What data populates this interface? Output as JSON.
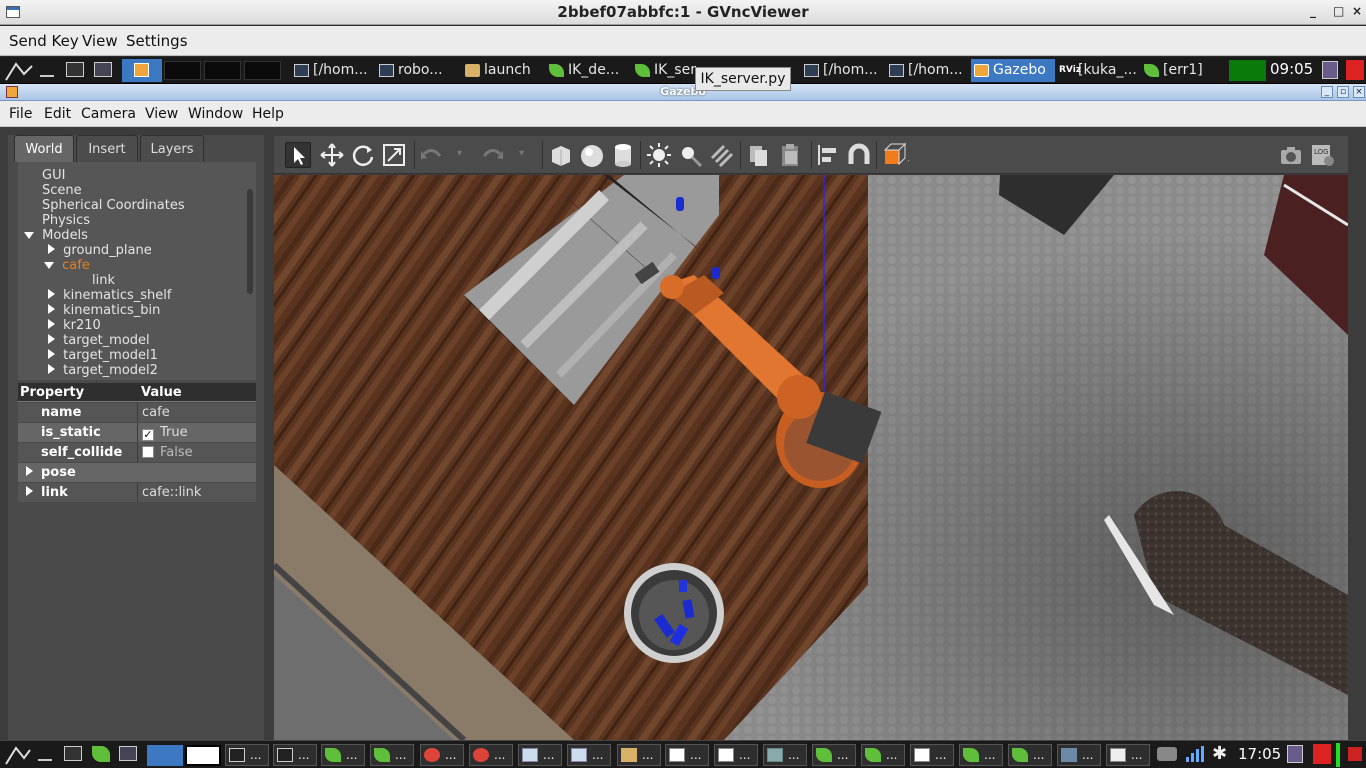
{
  "vnc": {
    "title": "2bbef07abbfc:1 - GVncViewer",
    "menu": [
      "Send Key",
      "View",
      "Settings"
    ],
    "win_buttons": [
      "_",
      "□",
      "×"
    ]
  },
  "top_panel": {
    "tasks": [
      {
        "icon": "terminal-icon",
        "label": "[/hom..."
      },
      {
        "icon": "terminal-icon",
        "label": "robo..."
      },
      {
        "icon": "folder-icon",
        "label": "launch"
      },
      {
        "icon": "leaf-icon",
        "label": "IK_de..."
      },
      {
        "icon": "leaf-icon",
        "label": "IK_ser"
      },
      {
        "icon": "terminal-icon",
        "label": "[/hom..."
      },
      {
        "icon": "terminal-icon",
        "label": "[/hom..."
      },
      {
        "icon": "gazebo-icon",
        "label": "Gazebo"
      },
      {
        "icon": "rviz-icon",
        "label": "[kuka_..."
      },
      {
        "icon": "leaf-icon",
        "label": "[err1]"
      }
    ],
    "clock": "09:05",
    "tooltip": "IK_server.py"
  },
  "gazebo": {
    "title": "Gazebo",
    "menu": [
      "File",
      "Edit",
      "Camera",
      "View",
      "Window",
      "Help"
    ],
    "tabs": [
      "World",
      "Insert",
      "Layers"
    ],
    "tree": {
      "items": [
        "GUI",
        "Scene",
        "Spherical Coordinates",
        "Physics"
      ],
      "models_label": "Models",
      "models": [
        "ground_plane",
        "cafe",
        "kinematics_shelf",
        "kinematics_bin",
        "kr210",
        "target_model",
        "target_model1",
        "target_model2"
      ],
      "cafe_child": "link"
    },
    "properties": {
      "header_property": "Property",
      "header_value": "Value",
      "rows": [
        {
          "name": "name",
          "value": "cafe"
        },
        {
          "name": "is_static",
          "value": "True"
        },
        {
          "name": "self_collide",
          "value": "False"
        },
        {
          "name": "pose",
          "value": ""
        },
        {
          "name": "link",
          "value": "cafe::link"
        }
      ]
    }
  },
  "bottom_panel": {
    "clock": "17:05",
    "item_label": "..."
  },
  "colors": {
    "accent": "#3d78c2",
    "selected_tree": "#e67e22",
    "robot": "#e0762f",
    "floor_wood": "#5b3520",
    "tile_floor": "#8c8c8c"
  }
}
